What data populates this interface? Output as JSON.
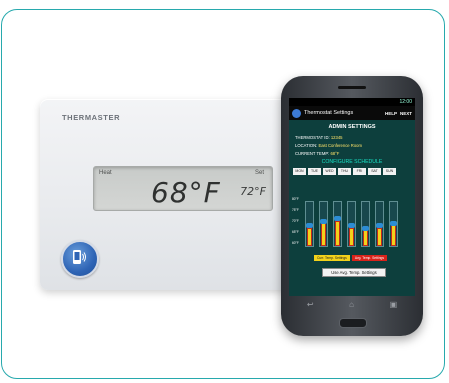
{
  "thermostat": {
    "brand": "THERMASTER",
    "mode_label": "Heat",
    "set_label": "Set",
    "current_temp": "68°F",
    "set_temp": "72°F",
    "nfc_icon": "phone-tap-icon"
  },
  "phone": {
    "status_time": "12:00",
    "app_title": "Thermostat Settings",
    "help_label": "HELP",
    "next_label": "NEXT",
    "section_title": "ADMIN SETTINGS",
    "thermostat_id_label": "THERMOSTAT ID:",
    "thermostat_id": "12345",
    "location_label": "LOCATION:",
    "location": "East Conference Room",
    "current_temp_label": "CURRENT TEMP:",
    "current_temp": "68°F",
    "schedule_title": "CONFIGURE SCHEDULE",
    "days": [
      "MON",
      "TUE",
      "WED",
      "THU",
      "FRI",
      "SAT",
      "SUN"
    ],
    "y_labels": [
      "80°F",
      "75°F",
      "70°F",
      "65°F",
      "60°F"
    ],
    "avg_button": "Use Avg. Temp. Settings",
    "legend_current": "Curr. Temp. Settings",
    "legend_avg": "Avg. Temp. Settings",
    "nav_icons": [
      "back-icon",
      "home-icon",
      "recent-apps-icon"
    ],
    "colors": {
      "screen": "#0d3f3d",
      "accent": "#18e0c4",
      "bar": "#f2d21b",
      "bar_border": "#c62a1b"
    }
  },
  "chart_data": {
    "type": "bar",
    "categories": [
      "MON",
      "TUE",
      "WED",
      "THU",
      "FRI",
      "SAT",
      "SUN"
    ],
    "series": [
      {
        "name": "Curr. Temp. Settings",
        "values": [
          68,
          70,
          71,
          68,
          68,
          68,
          69
        ]
      },
      {
        "name": "Avg. Temp. Settings",
        "values": [
          69,
          71,
          72,
          69,
          68,
          69,
          70
        ]
      }
    ],
    "ylim": [
      60,
      80
    ]
  }
}
